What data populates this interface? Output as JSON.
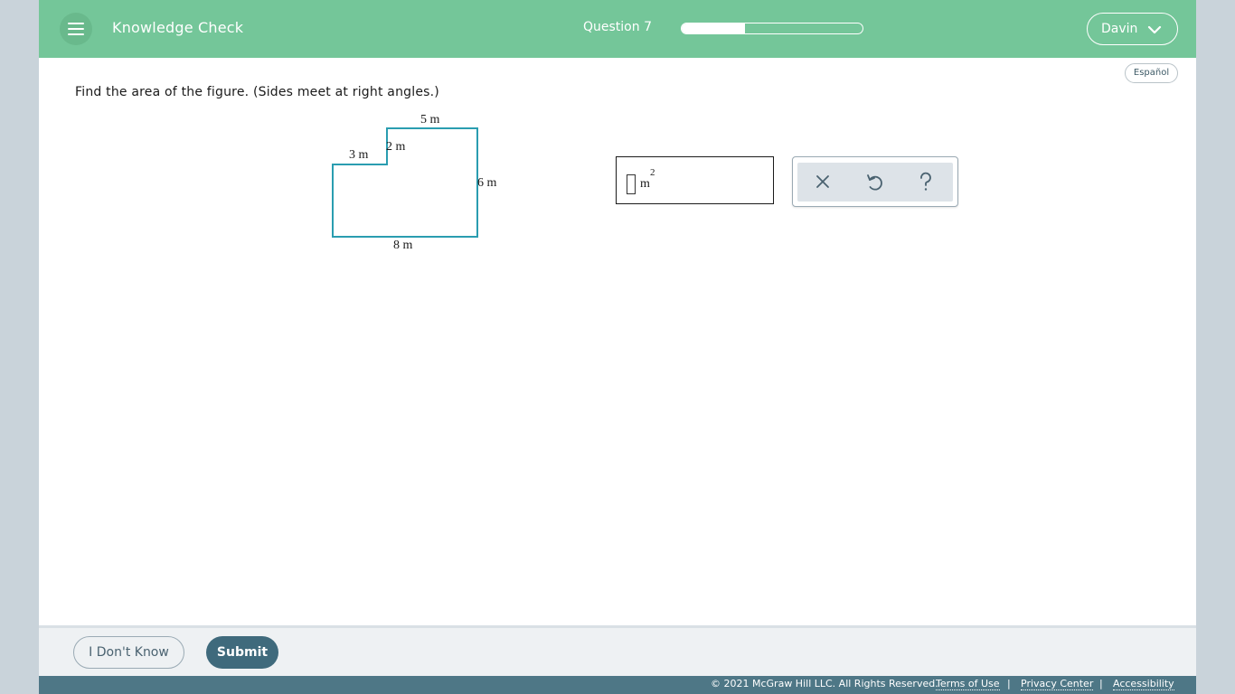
{
  "header": {
    "title": "Knowledge Check",
    "question_label": "Question 7",
    "progress_fraction": 0.35,
    "user_name": "Davin",
    "menu_icon": "hamburger-menu-icon",
    "user_menu_icon": "chevron-down-icon",
    "bg_color": "#74c699"
  },
  "language_button": "Español",
  "question": {
    "prompt": "Find the area of the figure. (Sides meet at right angles.)",
    "figure_labels": {
      "top": "5 m",
      "step": "2 m",
      "left_top": "3 m",
      "right": "6 m",
      "bottom": "8 m"
    },
    "figure_stroke_color": "#2a9db0"
  },
  "answer": {
    "value": "",
    "unit": "m",
    "unit_exponent": "2"
  },
  "tools": [
    {
      "icon": "close-icon",
      "name": "clear"
    },
    {
      "icon": "undo-icon",
      "name": "undo"
    },
    {
      "icon": "help-icon",
      "name": "help"
    }
  ],
  "footer": {
    "dont_know": "I Don't Know",
    "submit": "Submit",
    "copyright": "© 2021 McGraw Hill LLC. All Rights Reserved.",
    "links": [
      "Terms of Use",
      "Privacy Center",
      "Accessibility"
    ],
    "separator": "|"
  }
}
